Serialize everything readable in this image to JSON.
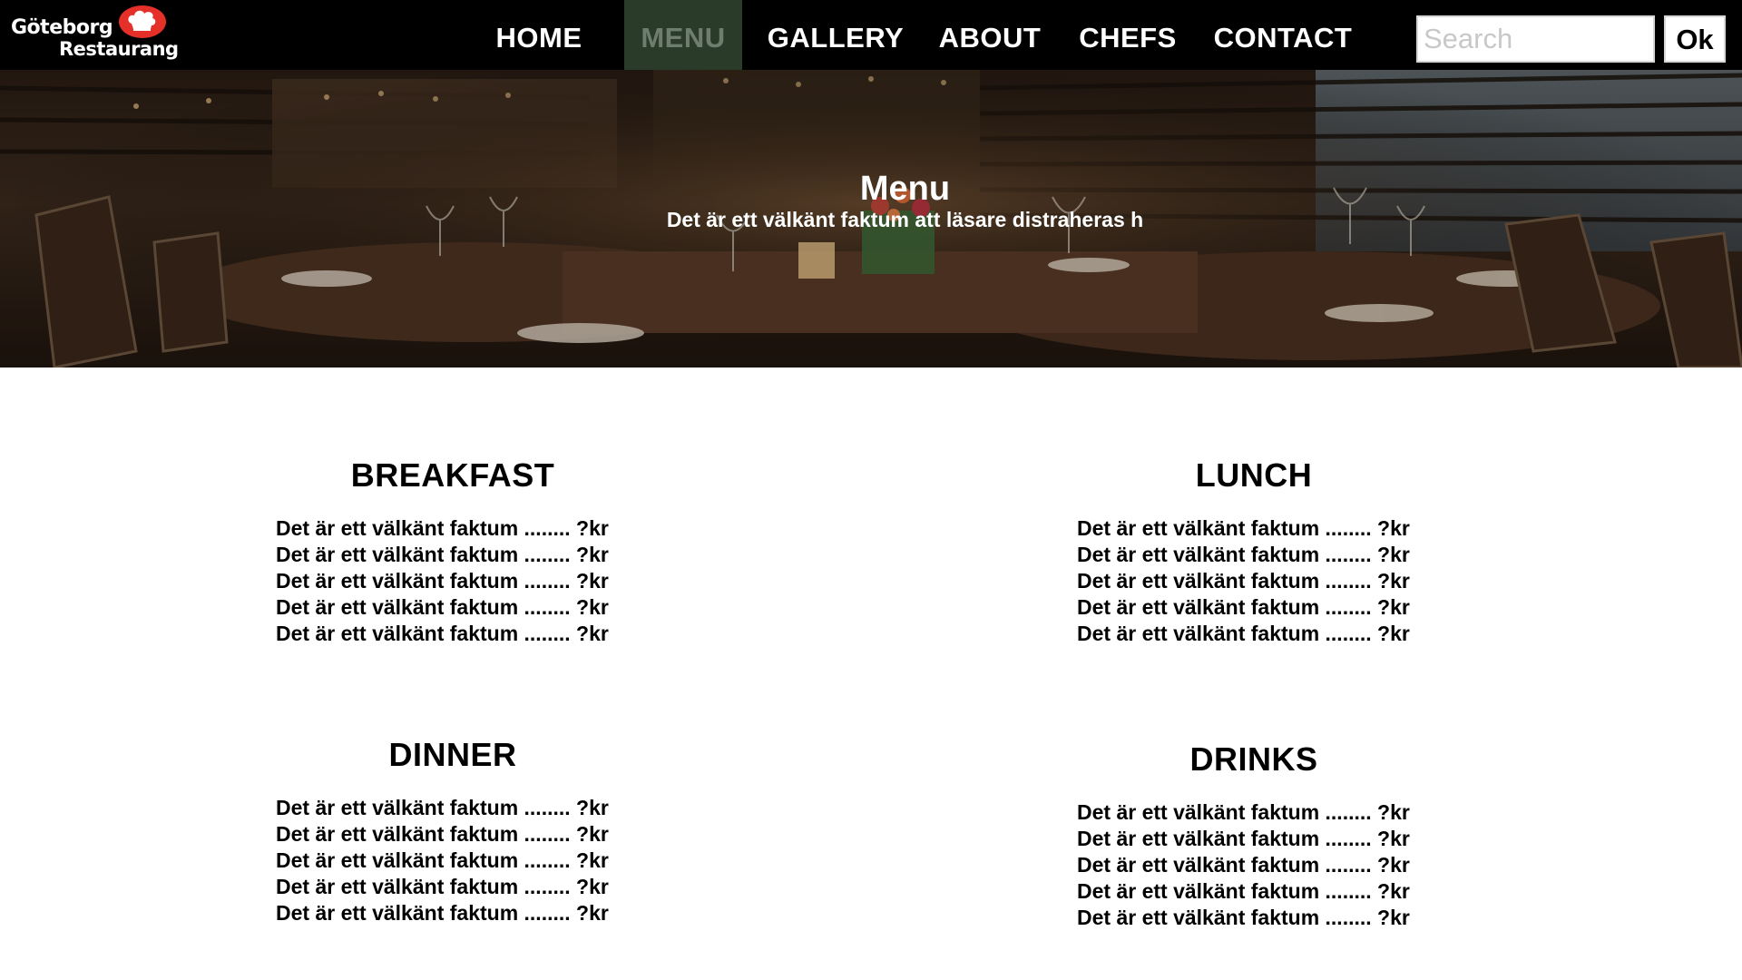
{
  "brand": {
    "line1": "Göteborg",
    "line2": "Restaurang",
    "hat_color": "#e5302a"
  },
  "nav": {
    "items": [
      {
        "label": "HOME",
        "active": false
      },
      {
        "label": "MENU",
        "active": true
      },
      {
        "label": "GALLERY",
        "active": false
      },
      {
        "label": "ABOUT",
        "active": false
      },
      {
        "label": "CHEFS",
        "active": false
      },
      {
        "label": "CONTACT",
        "active": false
      }
    ],
    "active_color": "#2a3b2a"
  },
  "search": {
    "placeholder": "Search",
    "value": "",
    "button_label": "Ok"
  },
  "hero": {
    "title": "Menu",
    "subtitle": "Det är ett välkänt faktum att läsare distraheras h"
  },
  "sections": [
    {
      "title": "BREAKFAST",
      "items": [
        "Det är ett välkänt faktum ........ ?kr",
        "Det är ett välkänt faktum ........ ?kr",
        "Det är ett välkänt faktum ........ ?kr",
        "Det är ett välkänt faktum ........ ?kr",
        "Det är ett välkänt faktum ........ ?kr"
      ]
    },
    {
      "title": "LUNCH",
      "items": [
        "Det är ett välkänt faktum ........ ?kr",
        "Det är ett välkänt faktum ........ ?kr",
        "Det är ett välkänt faktum ........ ?kr",
        "Det är ett välkänt faktum ........ ?kr",
        "Det är ett välkänt faktum ........ ?kr"
      ]
    },
    {
      "title": "DINNER",
      "items": [
        "Det är ett välkänt faktum ........ ?kr",
        "Det är ett välkänt faktum ........ ?kr",
        "Det är ett välkänt faktum ........ ?kr",
        "Det är ett välkänt faktum ........ ?kr",
        "Det är ett välkänt faktum ........ ?kr"
      ]
    },
    {
      "title": "DRINKS",
      "items": [
        "Det är ett välkänt faktum ........ ?kr",
        "Det är ett välkänt faktum ........ ?kr",
        "Det är ett välkänt faktum ........ ?kr",
        "Det är ett välkänt faktum ........ ?kr",
        "Det är ett välkänt faktum ........ ?kr"
      ]
    }
  ]
}
